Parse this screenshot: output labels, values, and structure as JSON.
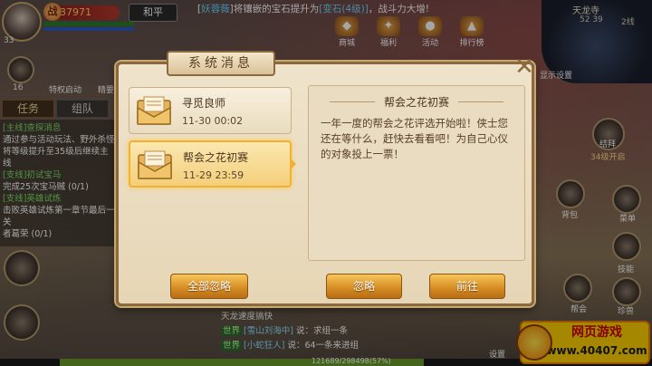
{
  "hud": {
    "power": "37971",
    "level": "33",
    "peace_mode": "和平",
    "broadcast": {
      "prefix": "[",
      "name": "妖蓉薇",
      "mid": "]将镶嵌的宝石提升为",
      "gem": "[变石(4级)]",
      "suffix": "，战斗力大增!"
    },
    "top_icons": [
      "商城",
      "福利",
      "活动",
      "排行榜"
    ],
    "map": {
      "name": "天龙寺",
      "coord": "52  39",
      "line": "2线",
      "setting": "显示设置"
    },
    "special_label": "特权启动",
    "special_level": "16",
    "elite_label": "精要",
    "tabs": {
      "task": "任务",
      "team": "组队"
    },
    "tasks": [
      {
        "tag": "[主线]",
        "text": "查探消息"
      },
      {
        "tag": "",
        "text": "通过参与活动玩法、野外杀怪"
      },
      {
        "tag": "",
        "text": "将等级提升至35级后继续主线"
      },
      {
        "tag": "[支线]",
        "text": "初试宝马"
      },
      {
        "tag": "",
        "text": "完成25次宝马贼 (0/1)"
      },
      {
        "tag": "[支线]",
        "text": "英雄试炼"
      },
      {
        "tag": "",
        "text": "击败英雄试炼第一章节最后一关"
      },
      {
        "tag": "",
        "text": "者葛荣 (0/1)"
      }
    ],
    "right_labels": {
      "bond": "结拜",
      "bond_open": "34级开启",
      "bag": "背包",
      "menu": "菜单",
      "skill": "技能",
      "pet": "珍兽",
      "guild": "帮会",
      "set": "设置"
    },
    "chat": {
      "speed": "天龙速度搞快",
      "rows": [
        {
          "channel": "世界",
          "user": "[雪山刘海中]",
          "msg": "说：求组一条"
        },
        {
          "channel": "世界",
          "user": "[小蛇狂人]",
          "msg": "说：64一条来进组"
        }
      ]
    },
    "xp_text": "121689/298498(57%)",
    "watermark": {
      "line1": "网页游戏",
      "line2": "www.40407.com"
    }
  },
  "dialog": {
    "title": "系统消息",
    "messages": [
      {
        "title": "寻觅良师",
        "date": "11-30  00:02"
      },
      {
        "title": "帮会之花初赛",
        "date": "11-29  23:59"
      }
    ],
    "detail": {
      "title": "帮会之花初赛",
      "body": "一年一度的帮会之花评选开始啦！侠士您还在等什么，赶快去看看吧！为自己心仪的对象投上一票！"
    },
    "buttons": {
      "ignore_all": "全部忽略",
      "ignore": "忽略",
      "go": "前往"
    }
  },
  "colors": {
    "dialog_bg": "#efe3cb",
    "dialog_border": "#8a6a3e",
    "selected_border": "#f0b030",
    "button_gold": "#d48a22"
  }
}
